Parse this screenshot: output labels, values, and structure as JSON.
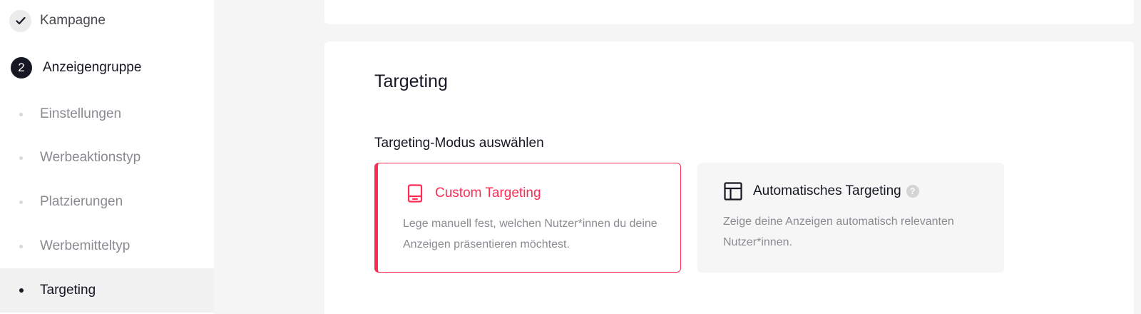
{
  "sidebar": {
    "campaign": {
      "label": "Kampagne",
      "icon": "check-icon",
      "state": "completed"
    },
    "adgroup": {
      "number": "2",
      "label": "Anzeigengruppe",
      "state": "active"
    },
    "items": [
      {
        "label": "Einstellungen"
      },
      {
        "label": "Werbeaktionstyp"
      },
      {
        "label": "Platzierungen"
      },
      {
        "label": "Werbemitteltyp"
      },
      {
        "label": "Targeting",
        "active": true
      }
    ]
  },
  "main": {
    "section_title": "Targeting",
    "mode_label": "Targeting-Modus auswählen",
    "options": [
      {
        "title": "Custom Targeting",
        "description": "Lege manuell fest, welchen Nutzer*innen du deine Anzeigen präsentieren möchtest.",
        "icon": "tablet-icon",
        "selected": true
      },
      {
        "title": "Automatisches Targeting",
        "description": "Zeige deine Anzeigen automatisch relevanten Nutzer*innen.",
        "icon": "layout-icon",
        "help": "?",
        "selected": false
      }
    ]
  },
  "colors": {
    "accent": "#fe2c55",
    "text_primary": "#161823",
    "text_secondary": "#8a8b91",
    "page_background": "#f5f5f5"
  }
}
